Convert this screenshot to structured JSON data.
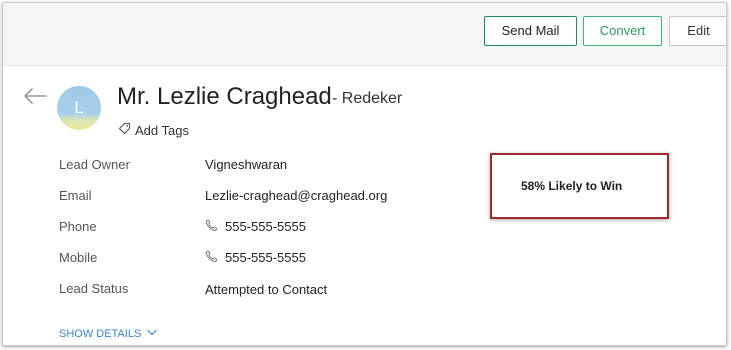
{
  "toolbar": {
    "send_mail_label": "Send Mail",
    "convert_label": "Convert",
    "edit_label": "Edit"
  },
  "lead": {
    "avatar_letter": "L",
    "name": "Mr. Lezlie Craghead",
    "company": "- Redeker",
    "add_tags_label": "Add Tags"
  },
  "fields": {
    "lead_owner": {
      "label": "Lead Owner",
      "value": "Vigneshwaran"
    },
    "email": {
      "label": "Email",
      "value": "Lezlie-craghead@craghead.org"
    },
    "phone": {
      "label": "Phone",
      "value": "555-555-5555"
    },
    "mobile": {
      "label": "Mobile",
      "value": "555-555-5555"
    },
    "lead_status": {
      "label": "Lead Status",
      "value": "Attempted to Contact"
    }
  },
  "show_details_label": "SHOW DETAILS",
  "win_score": {
    "text": "58% Likely to Win"
  },
  "icons": {
    "back": "back-arrow-icon",
    "tag": "tag-icon",
    "phone": "phone-icon",
    "chevron": "chevron-down-icon"
  },
  "colors": {
    "send_mail_border": "#1f8a5b",
    "convert": "#3cb878",
    "link": "#3b86c9",
    "score_border": "#a0282d"
  }
}
